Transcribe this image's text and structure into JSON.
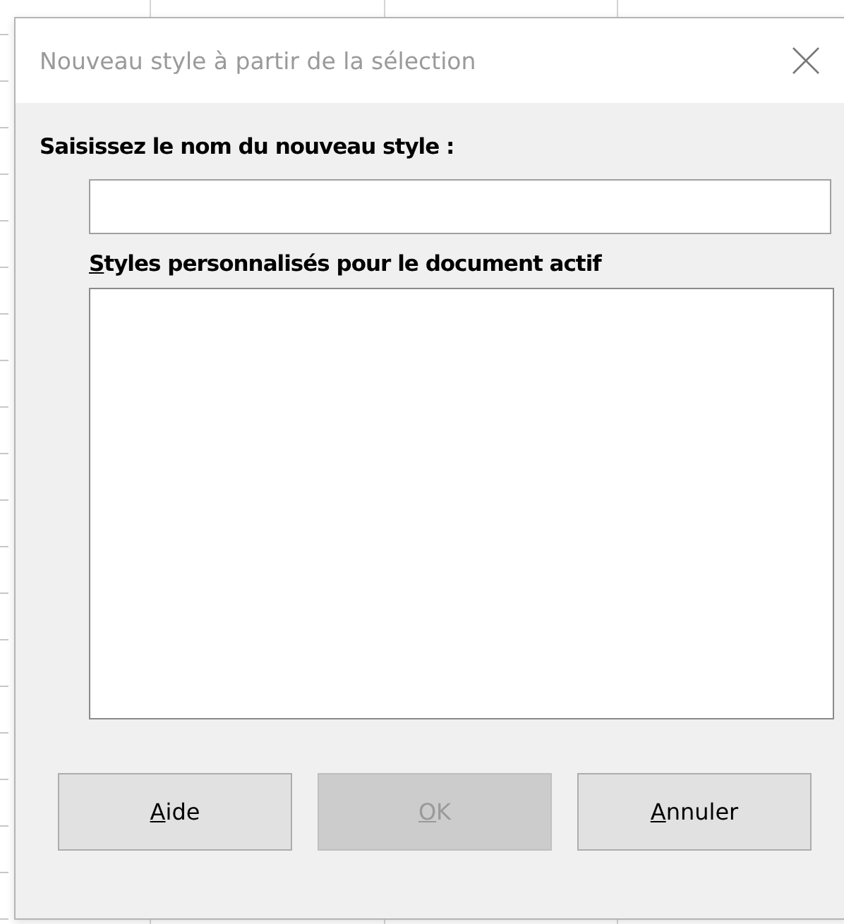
{
  "dialog": {
    "title": "Nouveau style à partir de la sélection"
  },
  "name_label": {
    "text": "Saisissez le nom du nouveau style :"
  },
  "styles_label": {
    "text": "Styles personnalisés pour le document actif",
    "mnemonic_underlined": true
  },
  "buttons": [
    {
      "label": "Aide",
      "disabled": false,
      "mnemonic_underlined": true
    },
    {
      "label": "OK",
      "disabled": true,
      "mnemonic_underlined": true
    },
    {
      "label": "Annuler",
      "disabled": false,
      "mnemonic_underlined": true
    }
  ]
}
